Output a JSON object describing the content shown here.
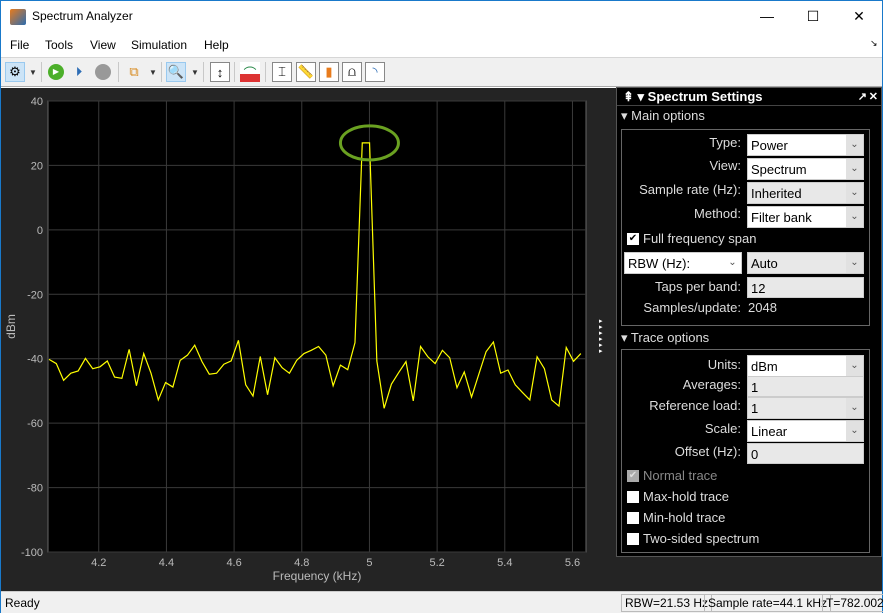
{
  "window": {
    "title": "Spectrum Analyzer",
    "minimize": "—",
    "maximize": "☐",
    "close": "✕"
  },
  "menu": [
    "File",
    "Tools",
    "View",
    "Simulation",
    "Help"
  ],
  "toolbar": {
    "icons": [
      "config-properties-icon",
      "run-icon",
      "step-forward-icon",
      "stop-icon",
      "signal-selector-icon",
      "zoom-x-icon",
      "scale-axes-icon",
      "spectrum-settings-icon",
      "data-cursors-icon",
      "measurements-icon",
      "peak-finder-icon",
      "distortion-icon",
      "ccdf-icon"
    ]
  },
  "chart_data": {
    "type": "line",
    "xlabel": "Frequency (kHz)",
    "ylabel": "dBm",
    "xlim": [
      4.05,
      5.64
    ],
    "ylim": [
      -100,
      40
    ],
    "xticks": [
      "4.2",
      "4.4",
      "4.6",
      "4.8",
      "5",
      "5.2",
      "5.4",
      "5.6"
    ],
    "xtick_values": [
      4.2,
      4.4,
      4.6,
      4.8,
      5.0,
      5.2,
      5.4,
      5.6
    ],
    "yticks": [
      "40",
      "20",
      "0",
      "-20",
      "-40",
      "-60",
      "-80",
      "-100"
    ],
    "ytick_values": [
      40,
      20,
      0,
      -20,
      -40,
      -60,
      -80,
      -100
    ],
    "grid": true,
    "color": "#ffff00",
    "x_start": 4.053,
    "x_step": 0.02153,
    "y": [
      -40.2,
      -41.5,
      -46.7,
      -44.5,
      -43.8,
      -39.9,
      -43.1,
      -42.5,
      -40.7,
      -45.7,
      -46.1,
      -37.1,
      -48.4,
      -38.4,
      -44.5,
      -52.8,
      -47.4,
      -48.8,
      -40.5,
      -38.9,
      -35.8,
      -40.9,
      -44.8,
      -44.5,
      -41.7,
      -40.7,
      -34.3,
      -48.1,
      -51.6,
      -39.3,
      -51.2,
      -39.7,
      -42.8,
      -44.5,
      -40.5,
      -38.4,
      -37.4,
      -36.2,
      -38.9,
      -48.4,
      -42.0,
      -43.4,
      -35.0,
      27,
      27,
      -40.7,
      -55.4,
      -47.9,
      -44.3,
      -40.9,
      -53.1,
      -36.2,
      -39.4,
      -41.5,
      -37.4,
      -39.7,
      -49.0,
      -44.1,
      -51.9,
      -44.8,
      -37.8,
      -34.8,
      -44.5,
      -43.5,
      -48.1,
      -50.5,
      -52.8,
      -39.4,
      -43.1,
      -52.8,
      -54.7,
      -36.5,
      -40.8,
      -38.4
    ],
    "annotation": {
      "type": "ellipse",
      "x": 5.0,
      "y": 27,
      "color": "#6aa121"
    }
  },
  "settings": {
    "title": "Spectrum Settings",
    "main_options": "Main options",
    "type_label": "Type:",
    "type_value": "Power",
    "view_label": "View:",
    "view_value": "Spectrum",
    "sample_rate_label": "Sample rate (Hz):",
    "sample_rate_value": "Inherited",
    "method_label": "Method:",
    "method_value": "Filter bank",
    "full_span_label": "Full frequency span",
    "full_span_checked": true,
    "rbw_label": "RBW (Hz):",
    "rbw_value": "Auto",
    "taps_label": "Taps per band:",
    "taps_value": "12",
    "samples_label": "Samples/update:",
    "samples_value": "2048",
    "trace_options": "Trace options",
    "units_label": "Units:",
    "units_value": "dBm",
    "averages_label": "Averages:",
    "averages_value": "1",
    "refload_label": "Reference load:",
    "refload_value": "1",
    "scale_label": "Scale:",
    "scale_value": "Linear",
    "offset_label": "Offset (Hz):",
    "offset_value": "0",
    "normal_trace": "Normal trace",
    "max_hold": "Max-hold trace",
    "min_hold": "Min-hold trace",
    "two_sided": "Two-sided spectrum"
  },
  "status": {
    "ready": "Ready",
    "rbw": "RBW=21.53 Hz",
    "sample_rate": "Sample rate=44.1 kHz",
    "time": "T=782.002"
  }
}
